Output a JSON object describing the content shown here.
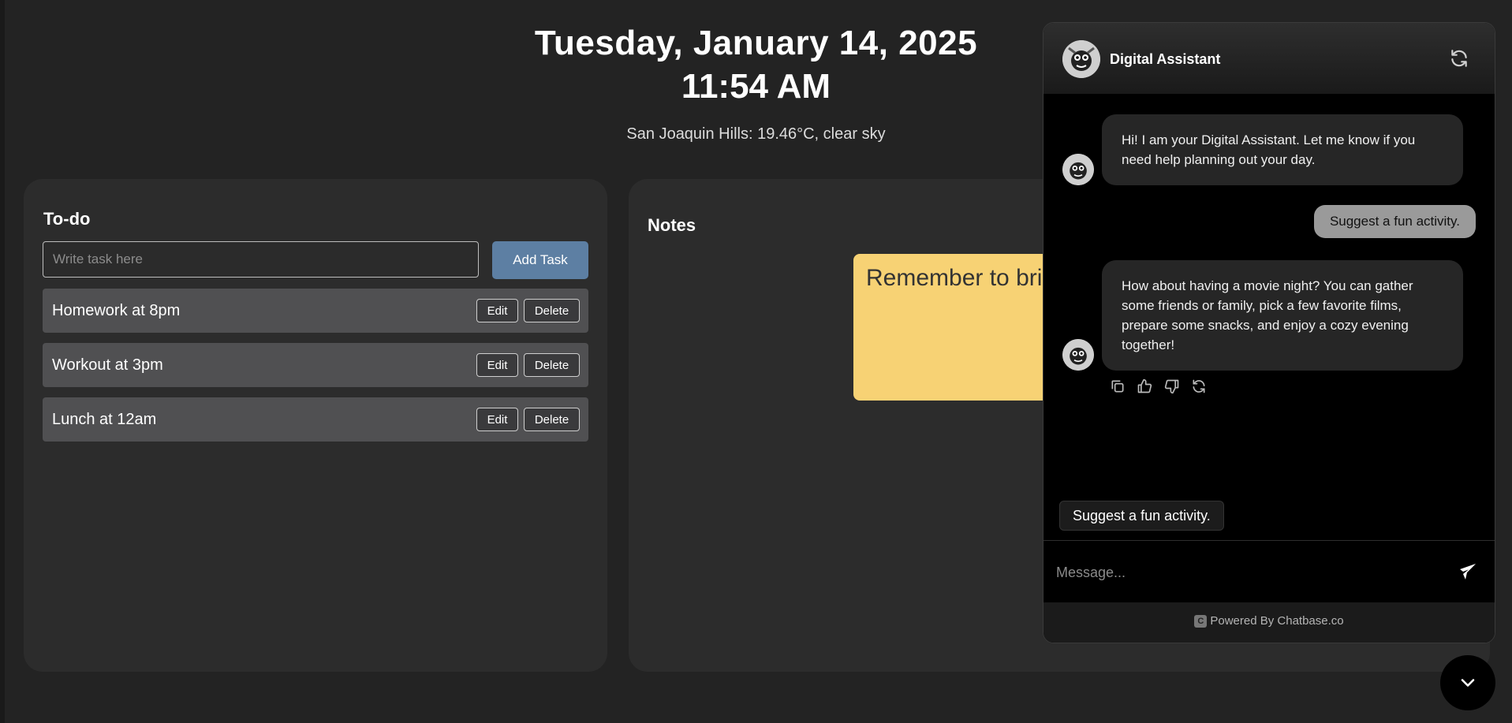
{
  "header": {
    "date": "Tuesday, January 14, 2025",
    "time": "11:54 AM",
    "weather": "San Joaquin Hills: 19.46°C, clear sky"
  },
  "todo": {
    "title": "To-do",
    "input_placeholder": "Write task here",
    "add_button": "Add Task",
    "edit_label": "Edit",
    "delete_label": "Delete",
    "tasks": [
      {
        "label": "Homework at 8pm"
      },
      {
        "label": "Workout at 3pm"
      },
      {
        "label": "Lunch at 12am"
      }
    ]
  },
  "notes": {
    "title": "Notes",
    "items": [
      {
        "text": "Remember to bri"
      }
    ]
  },
  "chat": {
    "title": "Digital Assistant",
    "messages": [
      {
        "role": "bot",
        "text": "Hi! I am your Digital Assistant. Let me know if you need help planning out your day."
      },
      {
        "role": "user",
        "text": "Suggest a fun activity."
      },
      {
        "role": "bot",
        "text": "How about having a movie night? You can gather some friends or family, pick a few favorite films, prepare some snacks, and enjoy a cozy evening together!"
      }
    ],
    "suggestion": "Suggest a fun activity.",
    "input_placeholder": "Message...",
    "footer": "Powered By Chatbase.co",
    "footer_logo": "C",
    "icons": [
      "refresh-icon",
      "copy-icon",
      "thumbs-up-icon",
      "thumbs-down-icon",
      "regenerate-icon",
      "send-icon",
      "chevron-down-icon"
    ]
  },
  "colors": {
    "background": "#232323",
    "panel": "#2c2c2c",
    "accent_button": "#5d7fa3",
    "sticky_note": "#f7d274",
    "chat_background": "#000000"
  }
}
